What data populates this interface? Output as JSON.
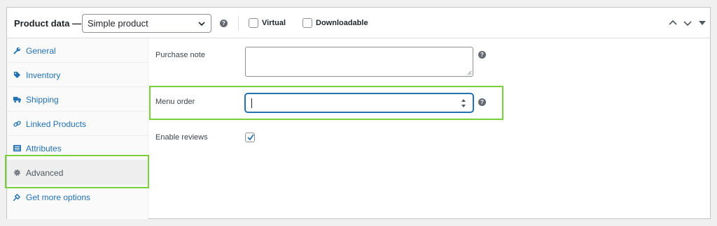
{
  "header": {
    "title": "Product data —",
    "product_type": "Simple product",
    "help_glyph": "?",
    "virtual_label": "Virtual",
    "downloadable_label": "Downloadable"
  },
  "tabs": [
    {
      "label": "General",
      "icon": "wrench-icon"
    },
    {
      "label": "Inventory",
      "icon": "tag-icon"
    },
    {
      "label": "Shipping",
      "icon": "truck-icon"
    },
    {
      "label": "Linked Products",
      "icon": "link-icon"
    },
    {
      "label": "Attributes",
      "icon": "list-icon"
    },
    {
      "label": "Advanced",
      "icon": "gear-icon",
      "active": true
    },
    {
      "label": "Get more options",
      "icon": "plugin-icon"
    }
  ],
  "fields": {
    "purchase_note_label": "Purchase note",
    "purchase_note_value": "",
    "menu_order_label": "Menu order",
    "menu_order_value": "",
    "enable_reviews_label": "Enable reviews",
    "enable_reviews_checked": true
  },
  "colors": {
    "accent": "#2271b1",
    "highlight": "#7ad03a"
  }
}
